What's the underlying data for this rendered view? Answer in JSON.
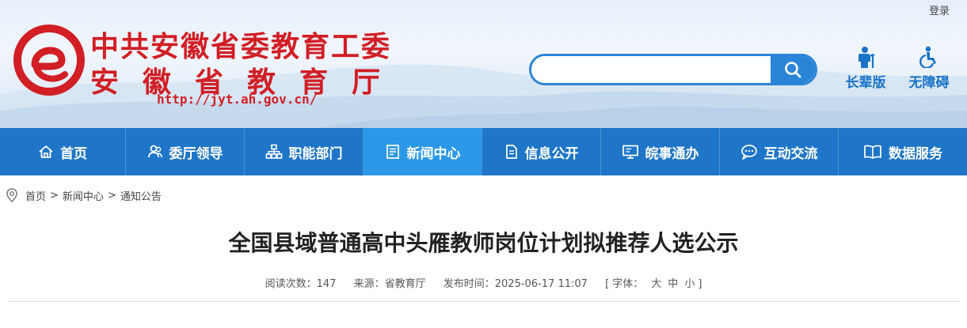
{
  "header": {
    "login_label": "登录",
    "org_name_line1": "中共安徽省委教育工委",
    "org_name_line2": "安徽省教育厅",
    "site_url": "http://jyt.ah.gov.cn/",
    "search": {
      "placeholder": "",
      "value": ""
    },
    "tools": [
      {
        "label": "长辈版",
        "icon": "elder-icon"
      },
      {
        "label": "无障碍",
        "icon": "accessibility-icon"
      }
    ]
  },
  "nav": {
    "items": [
      {
        "label": "首页",
        "icon": "home-icon",
        "active": false
      },
      {
        "label": "委厅领导",
        "icon": "leaders-icon",
        "active": false
      },
      {
        "label": "职能部门",
        "icon": "org-chart-icon",
        "active": false
      },
      {
        "label": "新闻中心",
        "icon": "news-icon",
        "active": true
      },
      {
        "label": "信息公开",
        "icon": "document-icon",
        "active": false
      },
      {
        "label": "皖事通办",
        "icon": "monitor-icon",
        "active": false
      },
      {
        "label": "互动交流",
        "icon": "chat-icon",
        "active": false
      },
      {
        "label": "数据服务",
        "icon": "book-icon",
        "active": false
      }
    ]
  },
  "breadcrumb": {
    "items": [
      "首页",
      "新闻中心",
      "通知公告"
    ],
    "separator": ">"
  },
  "article": {
    "title": "全国县域普通高中头雁教师岗位计划拟推荐人选公示",
    "views_label": "阅读次数：",
    "views": "147",
    "source_label": "来源：",
    "source": "省教育厅",
    "publish_label": "发布时间：",
    "publish_time": "2025-06-17 11:07",
    "font_size_prefix": "[ 字体：",
    "font_sizes": [
      "大",
      "中",
      "小"
    ],
    "font_size_suffix": "]"
  },
  "colors": {
    "brand_red": "#d21e25",
    "nav_blue": "#1f76c8",
    "nav_active": "#2c98e8",
    "search_blue": "#2a85d8"
  }
}
